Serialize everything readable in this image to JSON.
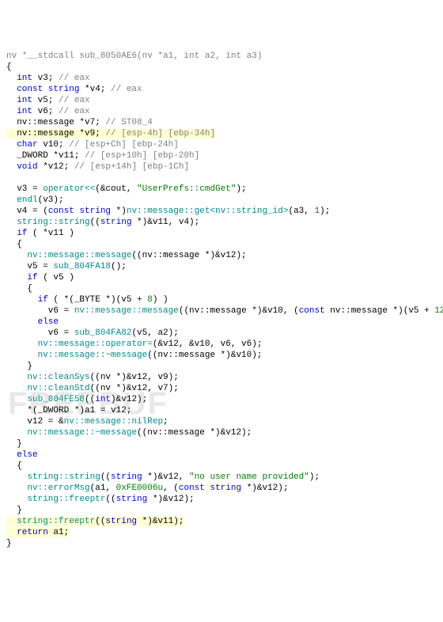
{
  "code": {
    "l1": {
      "a": "nv *__stdcall sub_8050AE6(nv *a1, int a2, int a3)"
    },
    "l2": "{",
    "l3": {
      "a": "  int",
      "b": " v3; ",
      "c": "// eax"
    },
    "l4": {
      "a": "  const string",
      "b": " *v4; ",
      "c": "// eax"
    },
    "l5": {
      "a": "  int",
      "b": " v5; ",
      "c": "// eax"
    },
    "l6": {
      "a": "  int",
      "b": " v6; ",
      "c": "// eax"
    },
    "l7": {
      "a": "  nv::message *v7; ",
      "c": "// ST08_4"
    },
    "l8": {
      "a": "  nv::message *v9; ",
      "c": "// [esp-4h] [ebp-34h]"
    },
    "l9": {
      "a": "  char",
      "b": " v10; ",
      "c": "// [esp+Ch] [ebp-24h]"
    },
    "l10": {
      "a": "  _DWORD *v11; ",
      "c": "// [esp+10h] [ebp-20h]"
    },
    "l11": {
      "a": "  void",
      "b": " *v12; ",
      "c": "// [esp+14h] [ebp-1Ch]"
    },
    "l12": " ",
    "l13": {
      "a": "  v3 = ",
      "b": "operator<<",
      "c": "(&cout, ",
      "d": "\"UserPrefs::cmdGet\"",
      "e": ");"
    },
    "l14": {
      "a": "  endl",
      "b": "(v3);"
    },
    "l15": {
      "a": "  v4 = (",
      "b": "const string",
      "c": " *)",
      "d": "nv::message::get<nv::string_id>",
      "e": "(a3, ",
      "f": "1",
      "g": ");"
    },
    "l16": {
      "a": "  string::string",
      "b": "((",
      "c": "string",
      "d": " *)&v11, v4);"
    },
    "l17": {
      "a": "  if",
      "b": " ( *v11 )"
    },
    "l18": "  {",
    "l19": {
      "a": "    nv::message::message",
      "b": "((nv::message *)&v12);"
    },
    "l20": {
      "a": "    v5 = ",
      "b": "sub_804FA18",
      "c": "();"
    },
    "l21": {
      "a": "    if",
      "b": " ( v5 )"
    },
    "l22": "    {",
    "l23": {
      "a": "      if",
      "b": " ( *(_BYTE *)(v5 + ",
      "c": "8",
      "d": ") )"
    },
    "l24": {
      "a": "        v6 = ",
      "b": "nv::message::message",
      "c": "((nv::message *)&v10, (",
      "d": "const",
      "e": " nv::message *)(v5 + ",
      "f": "12",
      "g": "));"
    },
    "l25": {
      "a": "      else"
    },
    "l26": {
      "a": "        v6 = ",
      "b": "sub_804FA82",
      "c": "(v5, a2);"
    },
    "l27": {
      "a": "      nv::message::operator=",
      "b": "(&v12, &v10, v6, v6);"
    },
    "l28": {
      "a": "      nv::message::~message",
      "b": "((nv::message *)&v10);"
    },
    "l29": "    }",
    "l30": {
      "a": "    nv::cleanSys",
      "b": "((nv *)&v12, v9);"
    },
    "l31": {
      "a": "    nv::cleanStd",
      "b": "((nv *)&v12, v7);"
    },
    "l32": {
      "a": "    sub_804FE58",
      "b": "((",
      "c": "int",
      "d": ")&v12);"
    },
    "l33": "    *(_DWORD *)a1 = v12;",
    "l34": {
      "a": "    v12 = &",
      "b": "nv::message::nilRep",
      "c": ";"
    },
    "l35": {
      "a": "    nv::message::~message",
      "b": "((nv::message *)&v12);"
    },
    "l36": "  }",
    "l37": {
      "a": "  else"
    },
    "l38": "  {",
    "l39": {
      "a": "    string::string",
      "b": "((",
      "c": "string",
      "d": " *)&v12, ",
      "e": "\"no user name provided\"",
      "f": ");"
    },
    "l40": {
      "a": "    nv::errorMsg",
      "b": "(a1, ",
      "c": "0xFE0006u",
      "d": ", (",
      "e": "const string",
      "f": " *)&v12);"
    },
    "l41": {
      "a": "    string::freeptr",
      "b": "((",
      "c": "string",
      "d": " *)&v12);"
    },
    "l42": "  }",
    "l43": {
      "a": "  string::freeptr",
      "b": "((",
      "c": "string",
      "d": " *)&v11);"
    },
    "l44": {
      "a": "  return",
      "b": " a1;"
    },
    "l45": "}"
  },
  "watermark": "FREEBUF"
}
